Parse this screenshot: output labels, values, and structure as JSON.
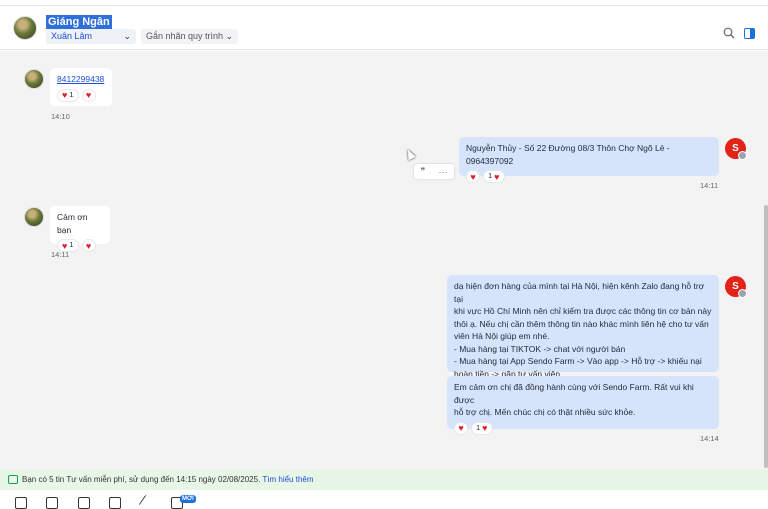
{
  "header": {
    "contact_name": "Giáng Ngân",
    "assignee": "Xuân Lâm",
    "tag_placeholder": "Gắn nhãn quy trình"
  },
  "messages": [
    {
      "direction": "in",
      "text": "8412299438",
      "reaction_count": "1",
      "time": "14:10"
    },
    {
      "direction": "out",
      "text": "Nguyễn Thủy - Số 22 Đường 08/3 Thôn Chợ Ngõ Lẻ - 0964397092",
      "reaction_count": "1",
      "time": "14:11"
    },
    {
      "direction": "in",
      "text": "Cảm ơn bạn",
      "reaction_count": "1",
      "time": "14:11"
    },
    {
      "direction": "out",
      "lines": [
        "dạ hiện đơn hàng của mình tại Hà Nội, hiện kênh Zalo đang hỗ trợ tại",
        "khi vực Hồ Chí Minh nên chỉ kiểm tra được các thông tin cơ bản này",
        "thôi ạ. Nếu chị cần thêm thông tin nào khác mình liên hệ cho tư vấn",
        "viên Hà Nội giúp em nhé.",
        "- Mua hàng tại TIKTOK -> chat với người bán",
        "- Mua hàng tại App Sendo Farm -> Vào app -> Hỗ trợ -> khiếu nại",
        "hoàn tiền -> gặp tư vấn viên."
      ]
    },
    {
      "direction": "out",
      "lines": [
        "Em cảm ơn chị đã đồng hành cùng với Sendo Farm. Rất vui khi được",
        "hỗ trợ chị. Mến chúc chị có thật nhiều sức khỏe."
      ],
      "reaction_count": "1",
      "time": "14:14"
    }
  ],
  "hover_tools": {
    "quote_glyph": "❞",
    "more_glyph": "···"
  },
  "notice": {
    "text": "Bạn có 5 tin Tư vấn miễn phí, sử dụng đến 14:15 ngày 02/08/2025.",
    "link": "Tìm hiểu thêm"
  },
  "toolbar": {
    "new_badge": "MỚI"
  },
  "icons": {
    "heart": "♥",
    "chevron": "⌄",
    "sendo_logo": "S"
  },
  "colors": {
    "accent": "#1d6fe0",
    "outgoing_bubble": "#d6e4fb",
    "heart": "#e11d2e",
    "sendo": "#e2231a"
  }
}
